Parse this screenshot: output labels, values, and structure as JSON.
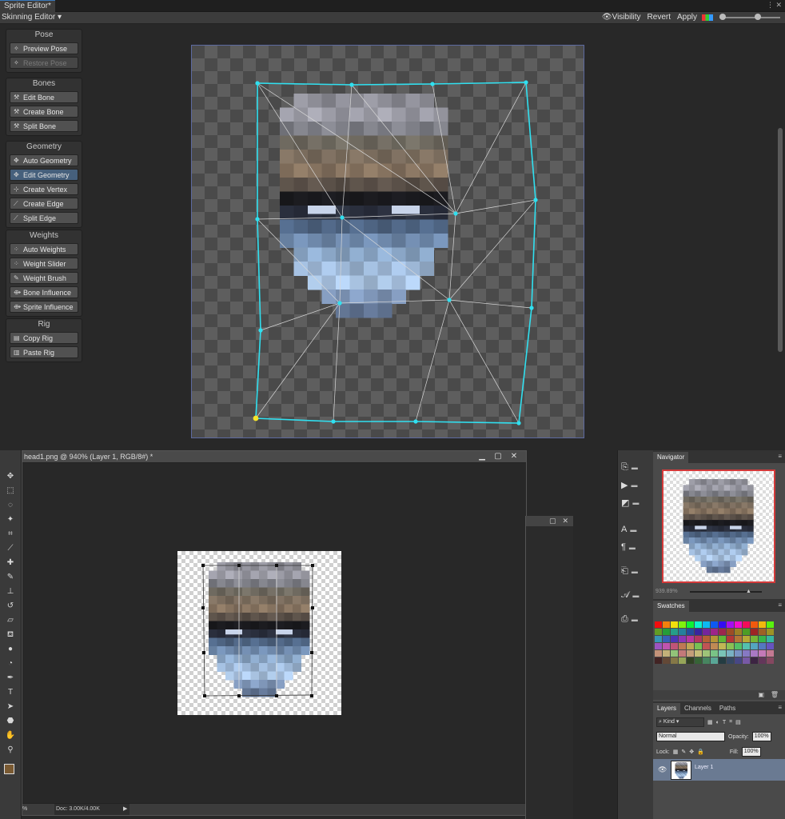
{
  "unity": {
    "tab_title": "Sprite Editor*",
    "mode_dropdown": "Skinning Editor",
    "toolbar": {
      "visibility": "Visibility",
      "revert": "Revert",
      "apply": "Apply"
    },
    "groups": [
      {
        "title": "Pose",
        "buttons": [
          {
            "label": "Preview Pose",
            "icon": "pose-icon",
            "state": "normal"
          },
          {
            "label": "Restore Pose",
            "icon": "pose-icon",
            "state": "disabled"
          }
        ]
      },
      {
        "title": "Bones",
        "buttons": [
          {
            "label": "Edit Bone",
            "icon": "bone-icon",
            "state": "normal"
          },
          {
            "label": "Create Bone",
            "icon": "bone-icon",
            "state": "normal"
          },
          {
            "label": "Split Bone",
            "icon": "bone-icon",
            "state": "normal"
          }
        ]
      },
      {
        "title": "Geometry",
        "buttons": [
          {
            "label": "Auto Geometry",
            "icon": "geometry-icon",
            "state": "normal"
          },
          {
            "label": "Edit Geometry",
            "icon": "geometry-icon",
            "state": "active"
          },
          {
            "label": "Create Vertex",
            "icon": "vertex-icon",
            "state": "normal"
          },
          {
            "label": "Create Edge",
            "icon": "edge-icon",
            "state": "normal"
          },
          {
            "label": "Split Edge",
            "icon": "edge-icon",
            "state": "normal"
          }
        ]
      },
      {
        "title": "Weights",
        "buttons": [
          {
            "label": "Auto Weights",
            "icon": "weights-icon",
            "state": "normal"
          },
          {
            "label": "Weight Slider",
            "icon": "weights-icon",
            "state": "normal"
          },
          {
            "label": "Weight Brush",
            "icon": "brush-icon",
            "state": "normal"
          },
          {
            "label": "Bone Influence",
            "icon": "influence-icon",
            "state": "normal"
          },
          {
            "label": "Sprite Influence",
            "icon": "influence-icon",
            "state": "normal"
          }
        ]
      },
      {
        "title": "Rig",
        "buttons": [
          {
            "label": "Copy Rig",
            "icon": "copy-icon",
            "state": "normal"
          },
          {
            "label": "Paste Rig",
            "icon": "paste-icon",
            "state": "normal"
          }
        ]
      }
    ],
    "accent": "#3a79bb",
    "mesh_color": "#30e0f0"
  },
  "photoshop": {
    "doc_title": "head1.png @ 940% (Layer 1, RGB/8#) *",
    "status": {
      "zoom": "%",
      "doc_size": "Doc: 3.00K/4.00K"
    },
    "navigator": {
      "tab": "Navigator",
      "zoom": "939.89%"
    },
    "swatches": {
      "tab": "Swatches"
    },
    "layers": {
      "tabs": [
        "Layers",
        "Channels",
        "Paths"
      ],
      "filter": "Kind",
      "blend_mode": "Normal",
      "opacity_label": "Opacity:",
      "opacity": "100%",
      "lock_label": "Lock:",
      "fill_label": "Fill:",
      "fill": "100%",
      "layer_name": "Layer 1"
    }
  }
}
